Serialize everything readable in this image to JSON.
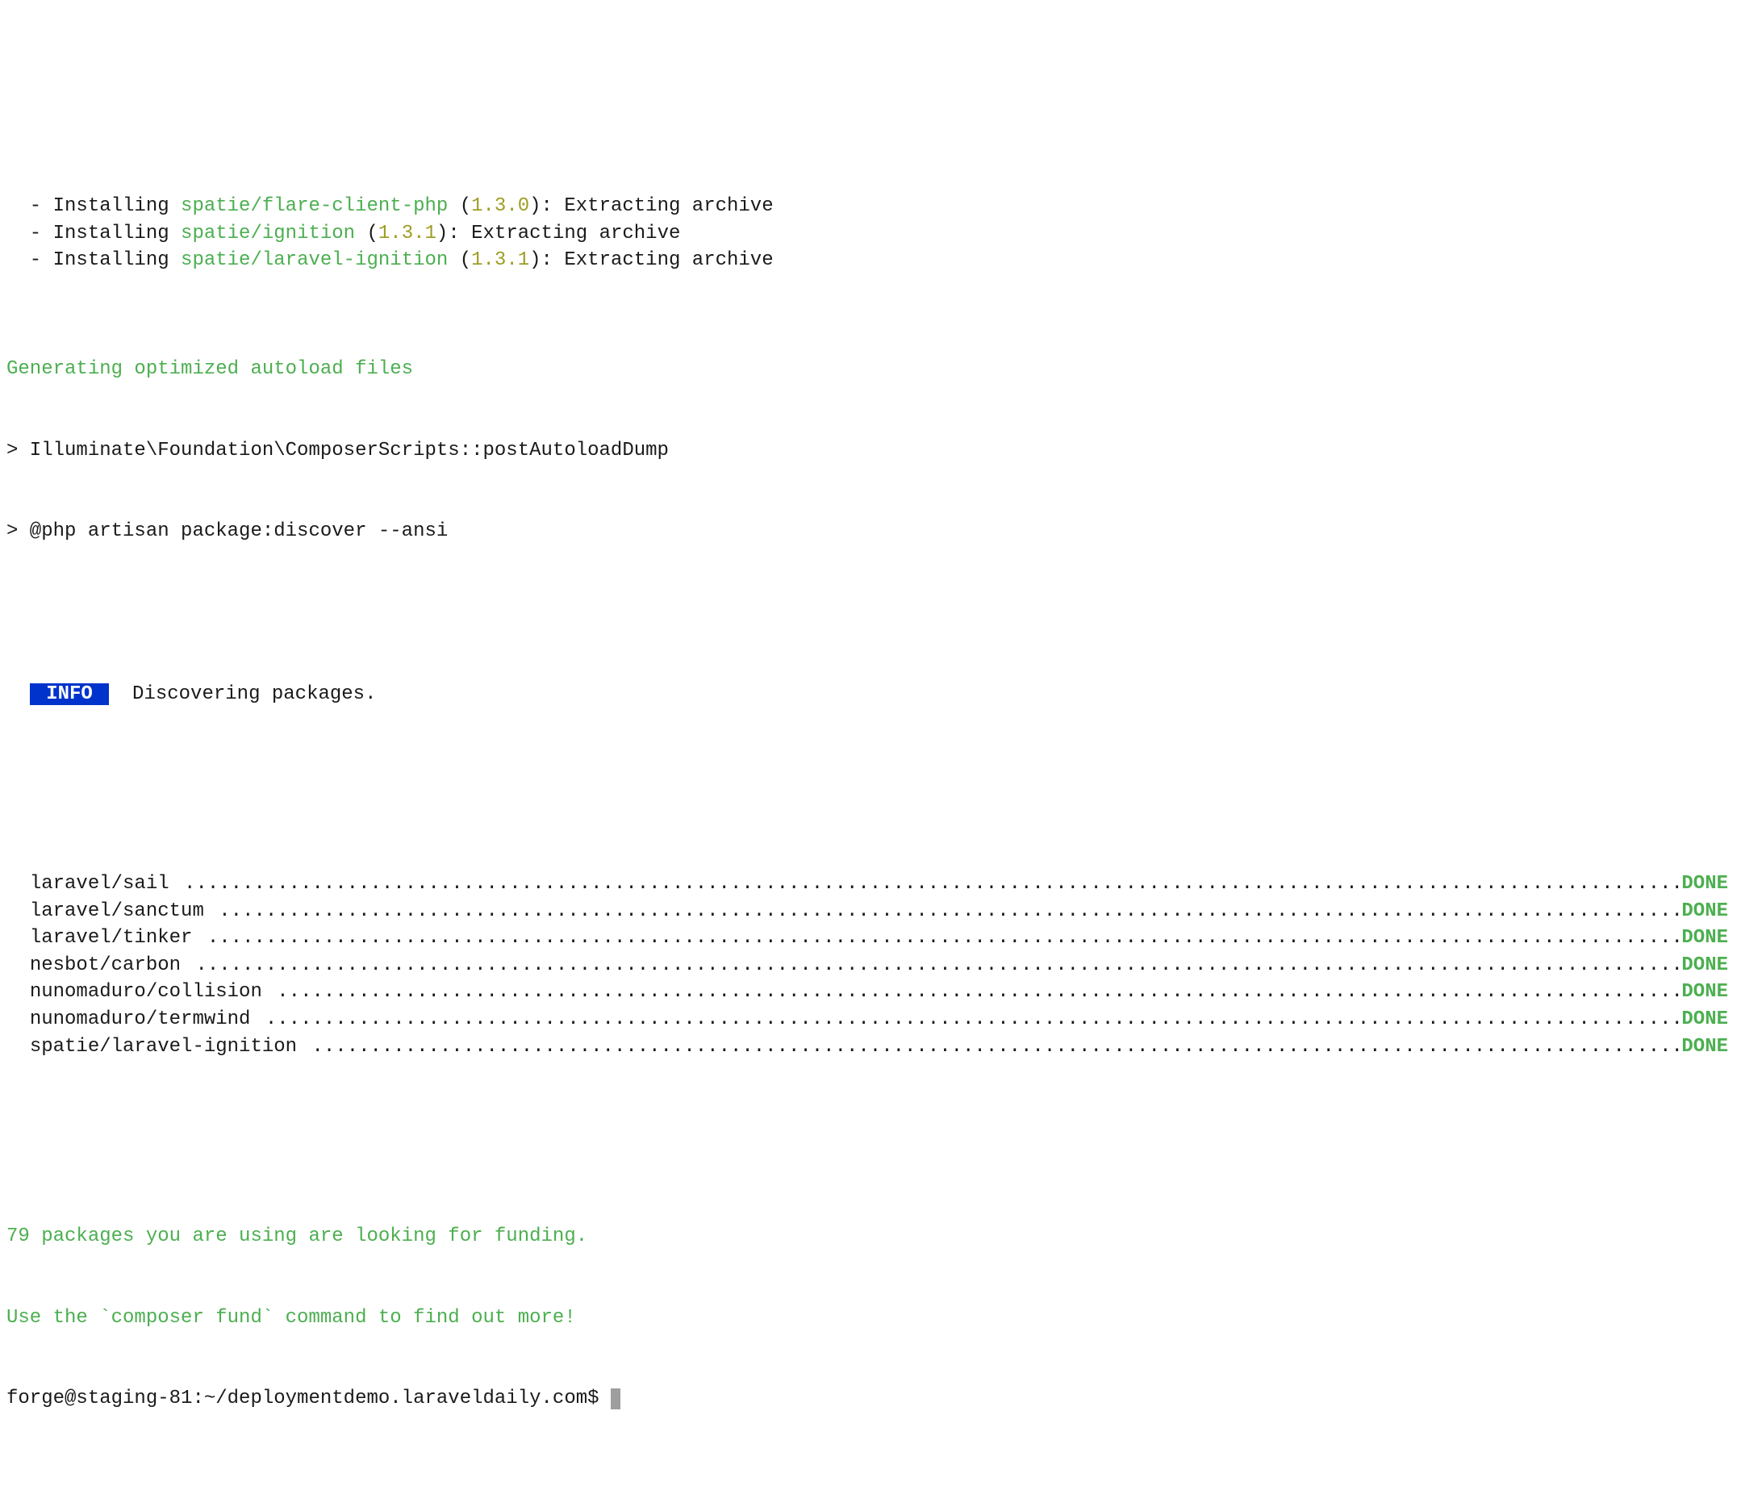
{
  "installs": [
    {
      "indent": "  - Installing ",
      "pkg": "spatie/flare-client-php",
      "open": " (",
      "ver": "1.3.0",
      "close": "): ",
      "tail": "Extracting archive"
    },
    {
      "indent": "  - Installing ",
      "pkg": "spatie/ignition",
      "open": " (",
      "ver": "1.3.1",
      "close": "): ",
      "tail": "Extracting archive"
    },
    {
      "indent": "  - Installing ",
      "pkg": "spatie/laravel-ignition",
      "open": " (",
      "ver": "1.3.1",
      "close": "): ",
      "tail": "Extracting archive"
    }
  ],
  "autoload_msg": "Generating optimized autoload files",
  "script1": "> Illuminate\\Foundation\\ComposerScripts::postAutoloadDump",
  "script2": "> @php artisan package:discover --ansi",
  "info_badge": " INFO ",
  "info_text": "  Discovering packages.",
  "info_lead": "  ",
  "discover_indent": "  ",
  "discover": [
    {
      "name": "laravel/sail",
      "status": "DONE"
    },
    {
      "name": "laravel/sanctum",
      "status": "DONE"
    },
    {
      "name": "laravel/tinker",
      "status": "DONE"
    },
    {
      "name": "nesbot/carbon",
      "status": "DONE"
    },
    {
      "name": "nunomaduro/collision",
      "status": "DONE"
    },
    {
      "name": "nunomaduro/termwind",
      "status": "DONE"
    },
    {
      "name": "spatie/laravel-ignition",
      "status": "DONE"
    }
  ],
  "funding1": "79 packages you are using are looking for funding.",
  "funding2": "Use the `composer fund` command to find out more!",
  "prompt": "forge@staging-81:~/deploymentdemo.laraveldaily.com$ ",
  "dots": " ........................................................................................................................................................ "
}
